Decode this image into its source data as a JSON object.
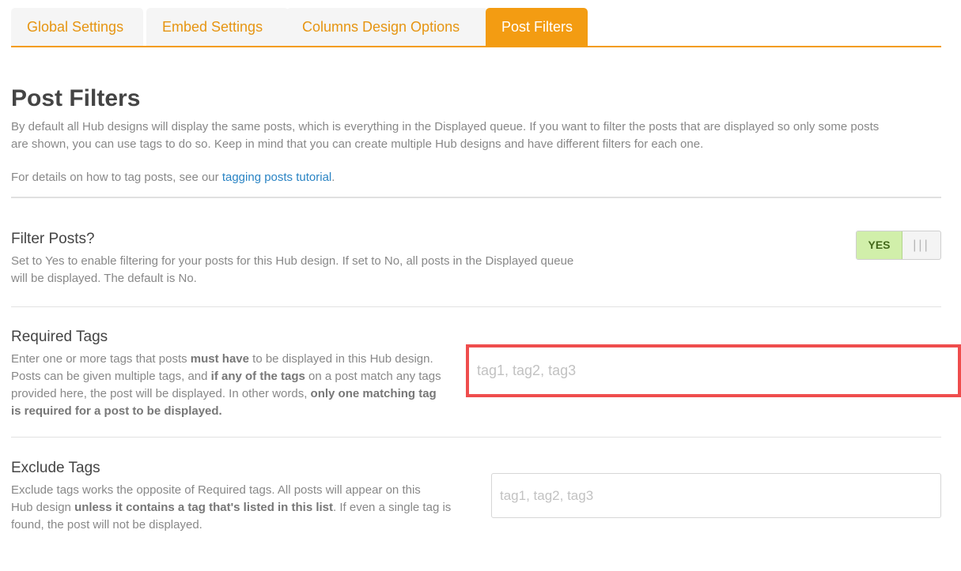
{
  "tabs": [
    {
      "label": "Global Settings",
      "active": false
    },
    {
      "label": "Embed Settings",
      "active": false
    },
    {
      "label": "Columns Design Options",
      "active": false
    },
    {
      "label": "Post Filters",
      "active": true
    }
  ],
  "page": {
    "title": "Post Filters",
    "intro_line1": "By default all Hub designs will display the same posts, which is everything in the Displayed queue. If you want to filter the posts that are displayed so only some posts",
    "intro_line2": "are shown, you can use tags to do so. Keep in mind that you can create multiple Hub designs and have different filters for each one.",
    "details_prefix": "For details on how to tag posts, see our ",
    "details_link": "tagging posts tutorial",
    "details_suffix": "."
  },
  "filter_posts": {
    "label": "Filter Posts?",
    "desc_line1": "Set to Yes to enable filtering for your posts for this Hub design. If set to No, all posts in the Displayed queue",
    "desc_line2": "will be displayed. The default is No.",
    "toggle_label": "YES",
    "toggle_grip": "|||",
    "enabled": true
  },
  "required_tags": {
    "label": "Required Tags",
    "l1_a": "Enter one or more tags that posts ",
    "l1_b": "must have",
    "l1_c": " to be displayed in this Hub design.",
    "l2_a": "Posts can be given multiple tags, and ",
    "l2_b": "if any of the tags",
    "l2_c": " on a post match any tags",
    "l3_a": "provided here, the post will be displayed. In other words, ",
    "l3_b": "only one matching tag",
    "l4_b": "is required for a post to be displayed.",
    "placeholder": "tag1, tag2, tag3",
    "value": ""
  },
  "exclude_tags": {
    "label": "Exclude Tags",
    "l1": "Exclude tags works the opposite of Required tags. All posts will appear on this",
    "l2_a": "Hub design ",
    "l2_b": "unless it contains a tag that's listed in this list",
    "l2_c": ". If even a single tag is",
    "l3": "found, the post will not be displayed.",
    "placeholder": "tag1, tag2, tag3",
    "value": ""
  },
  "colors": {
    "accent": "#f39c12",
    "link": "#2a84c4",
    "highlight_border": "#ef4d4d",
    "toggle_yes": "#d1efaa"
  }
}
